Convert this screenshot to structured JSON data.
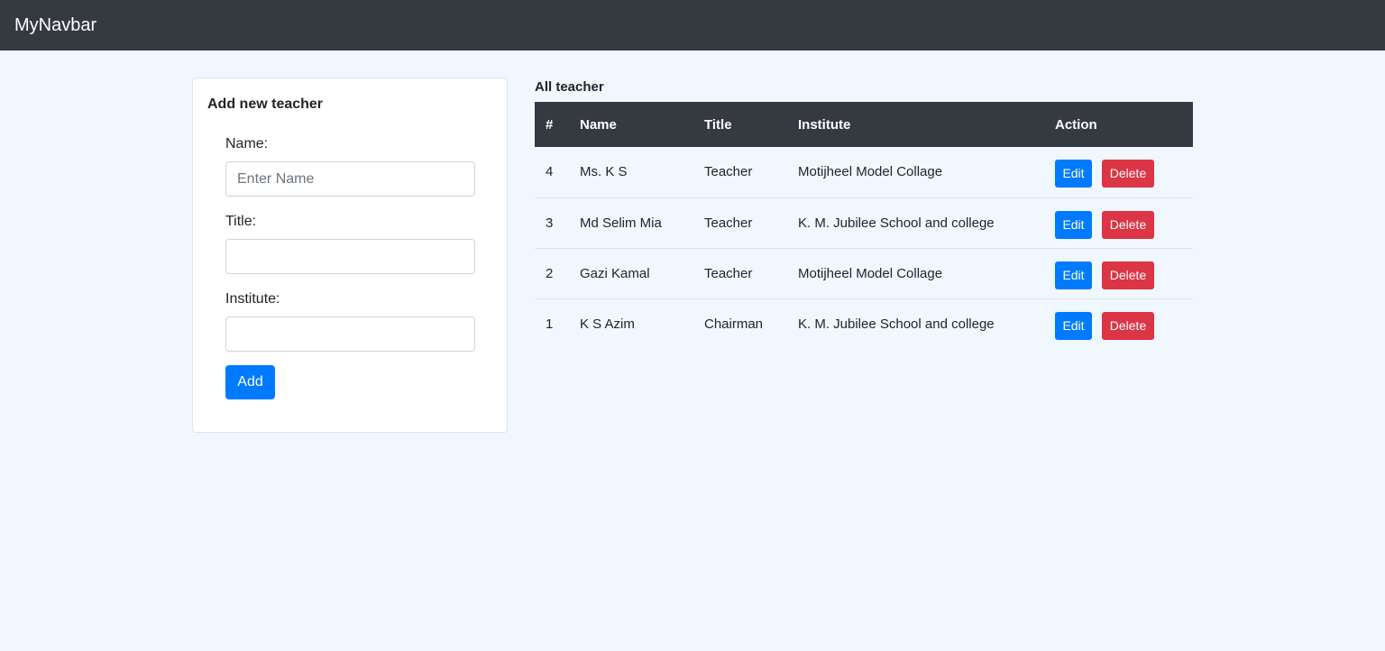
{
  "navbar": {
    "brand": "MyNavbar"
  },
  "form": {
    "title": "Add new teacher",
    "name_label": "Name:",
    "name_placeholder": "Enter Name",
    "name_value": "",
    "title_label": "Title:",
    "title_value": "",
    "institute_label": "Institute:",
    "institute_value": "",
    "add_label": "Add"
  },
  "table": {
    "heading": "All teacher",
    "columns": [
      "#",
      "Name",
      "Title",
      "Institute",
      "Action"
    ],
    "rows": [
      {
        "id": "4",
        "name": "Ms. K S",
        "title": "Teacher",
        "institute": "Motijheel Model Collage"
      },
      {
        "id": "3",
        "name": "Md Selim Mia",
        "title": "Teacher",
        "institute": "K. M. Jubilee School and college"
      },
      {
        "id": "2",
        "name": "Gazi Kamal",
        "title": "Teacher",
        "institute": "Motijheel Model Collage"
      },
      {
        "id": "1",
        "name": "K S Azim",
        "title": "Chairman",
        "institute": "K. M. Jubilee School and college"
      }
    ],
    "edit_label": "Edit",
    "delete_label": "Delete"
  },
  "colors": {
    "navbar_bg": "#343a40",
    "page_bg": "#f0f7fe",
    "primary": "#007bff",
    "danger": "#dc3545"
  }
}
